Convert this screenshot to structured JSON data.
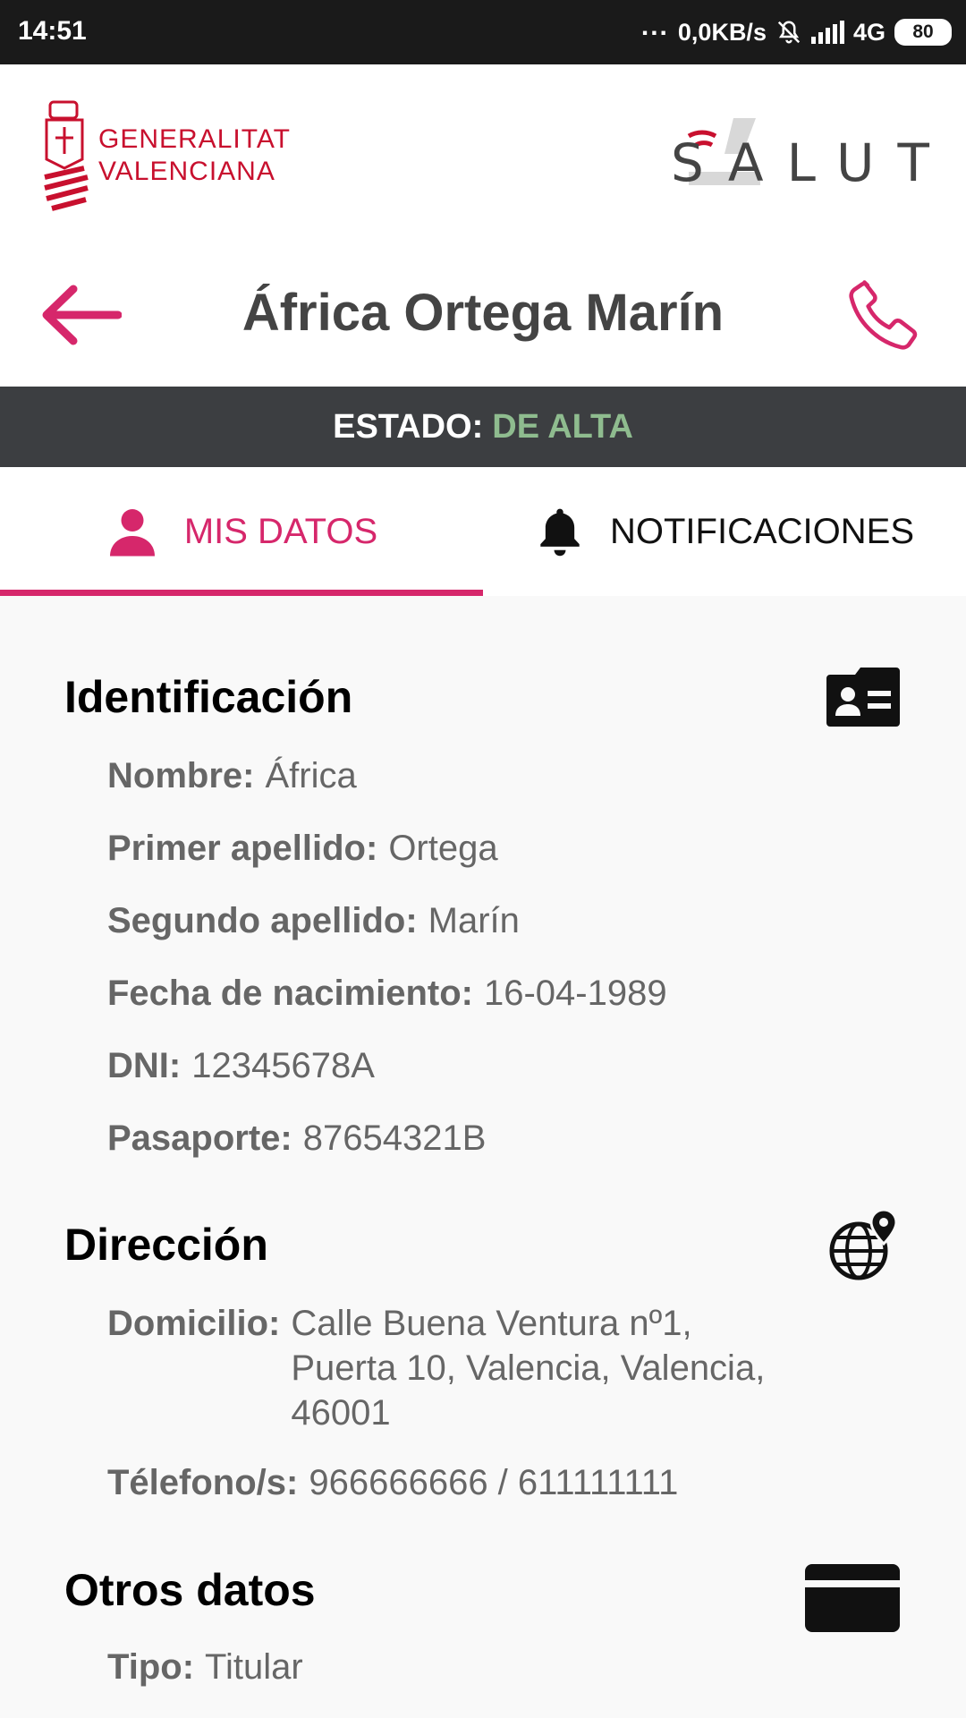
{
  "statusbar": {
    "time": "14:51",
    "dots": "...",
    "network_speed": "0,0KB/s",
    "network_type": "4G",
    "battery": "80",
    "icons": [
      "mute-bell-icon",
      "signal-icon",
      "battery-icon"
    ]
  },
  "logos": {
    "left_line1": "GENERALITAT",
    "left_line2": "VALENCIANA",
    "right": "SALUT"
  },
  "header": {
    "title": "África Ortega Marín"
  },
  "status": {
    "label": "ESTADO:",
    "value": "DE ALTA"
  },
  "tabs": [
    {
      "label": "MIS DATOS",
      "icon": "person-icon",
      "active": true
    },
    {
      "label": "NOTIFICACIONES",
      "icon": "bell-icon",
      "active": false
    }
  ],
  "sections": {
    "identificacion": {
      "title": "Identificación",
      "icon": "id-card-icon",
      "fields": [
        {
          "label": "Nombre:",
          "value": "África"
        },
        {
          "label": "Primer apellido:",
          "value": "Ortega"
        },
        {
          "label": "Segundo apellido:",
          "value": "Marín"
        },
        {
          "label": "Fecha de nacimiento:",
          "value": "16-04-1989"
        },
        {
          "label": "DNI:",
          "value": "12345678A"
        },
        {
          "label": "Pasaporte:",
          "value": "87654321B"
        }
      ]
    },
    "direccion": {
      "title": "Dirección",
      "icon": "globe-location-icon",
      "fields": [
        {
          "label": "Domicilio:",
          "value": "Calle Buena Ventura nº1,\nPuerta 10, Valencia, Valencia,\n46001"
        },
        {
          "label": "Télefono/s:",
          "value": "966666666 / 611111111"
        }
      ]
    },
    "otros": {
      "title": "Otros datos",
      "icon": "card-icon",
      "fields": [
        {
          "label": "Tipo:",
          "value": "Titular"
        }
      ]
    }
  },
  "colors": {
    "accent": "#d6276b",
    "brand_red": "#c8102e",
    "status_bg": "#3c3e41",
    "status_ok": "#8fbc8f"
  }
}
